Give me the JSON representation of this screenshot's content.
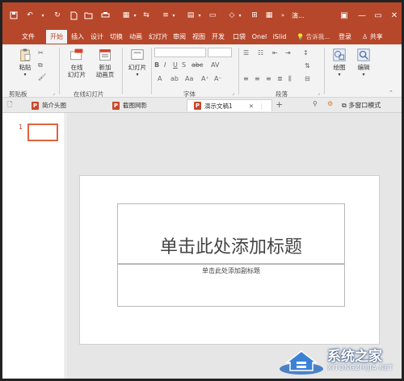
{
  "window": {
    "title": "演...",
    "minimize_label": "—",
    "maximize_label": "▭",
    "close_label": "✕",
    "ribbon_display_label": "▣"
  },
  "tabs": [
    {
      "label": "文件"
    },
    {
      "label": "开始",
      "active": true
    },
    {
      "label": "插入"
    },
    {
      "label": "设计"
    },
    {
      "label": "切换"
    },
    {
      "label": "动画"
    },
    {
      "label": "幻灯片"
    },
    {
      "label": "审阅"
    },
    {
      "label": "视图"
    },
    {
      "label": "开发"
    },
    {
      "label": "口袋"
    },
    {
      "label": "Onel"
    },
    {
      "label": "iSlid"
    }
  ],
  "tell_me": "告诉我...",
  "sign_in": "登录",
  "share": "共享",
  "ribbon": {
    "paste_label": "粘贴",
    "online_slides_label": "在线\n幻灯片",
    "new_animated_page_label": "新加\n动画页",
    "slides_label": "幻灯片",
    "drawing_label": "绘图",
    "editing_label": "编辑",
    "groups": {
      "clipboard": "剪贴板",
      "online_slides": "在线幻灯片",
      "font": "字体",
      "paragraph": "段落"
    },
    "bold": "B",
    "italic": "I",
    "underline": "U",
    "strike": "S",
    "abc": "abc",
    "av": "AV",
    "aa": "Aa"
  },
  "doc_tabs": [
    {
      "label": "简介头图"
    },
    {
      "label": "截图网影"
    },
    {
      "label": "演示文稿1",
      "active": true
    }
  ],
  "doc_tab_close": "✕",
  "doc_tab_add": "+",
  "multi_window_label": "多窗口模式",
  "thumbnail": {
    "number": "1"
  },
  "slide": {
    "title_placeholder": "单击此处添加标题",
    "subtitle_placeholder": "单击此处添加副标题"
  },
  "watermark": {
    "name": "系统之家",
    "url": "XITONGZHIJIA.NET"
  },
  "colors": {
    "accent": "#b7472a",
    "ribbon_bg": "#f3f3f3",
    "canvas_bg": "#e6e6e6"
  }
}
